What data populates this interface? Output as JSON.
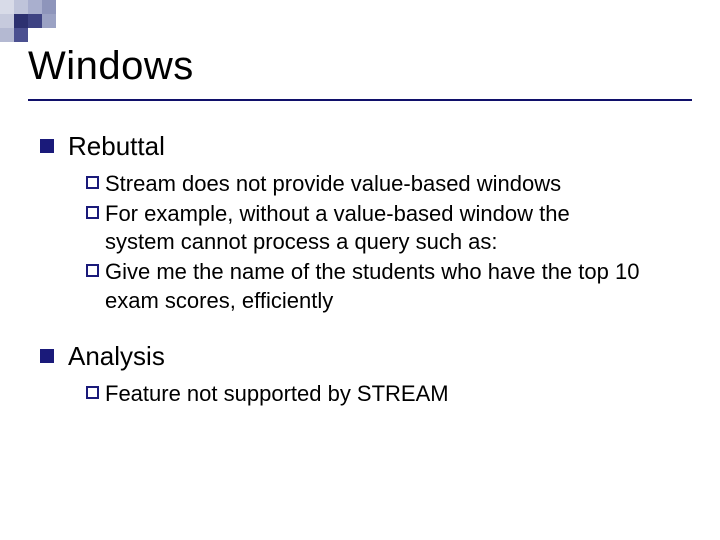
{
  "title": "Windows",
  "sections": [
    {
      "heading": "Rebuttal",
      "items": [
        "Stream does not provide value-based windows",
        "For example, without a value-based window the system cannot process a query such as:",
        "Give me the name of the students who have the top 10 exam scores, efficiently"
      ]
    },
    {
      "heading": "Analysis",
      "items": [
        "Feature not supported by STREAM"
      ]
    }
  ],
  "deco_colors": [
    [
      "#d8dbe8",
      "#bfc4da",
      "#a9afce",
      "#8e95bb"
    ],
    [
      "#c6cadd",
      "#2d3170",
      "#3e4383",
      "#9ba2c4"
    ],
    [
      "#b4b9d2",
      "#4b5090",
      "#ffffff",
      "#ffffff"
    ]
  ]
}
